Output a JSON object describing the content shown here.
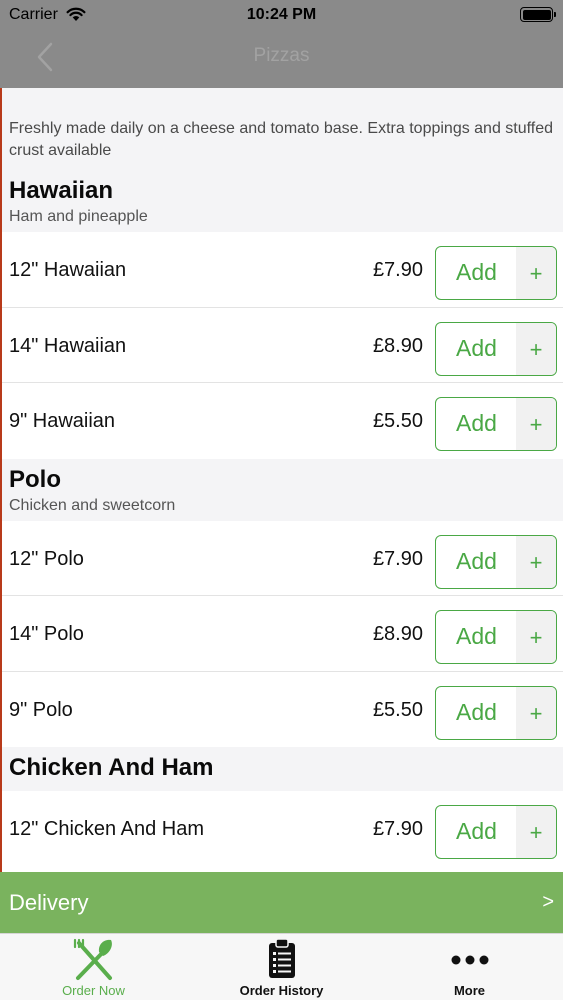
{
  "status_bar": {
    "carrier": "Carrier",
    "time": "10:24 PM"
  },
  "nav": {
    "title": "Pizzas"
  },
  "intro_text": "Freshly made daily on a cheese and tomato base. Extra toppings and stuffed crust available",
  "sections": [
    {
      "title": "Hawaiian",
      "subtitle": "Ham and pineapple",
      "items": [
        {
          "name": "12\" Hawaiian",
          "price": "£7.90"
        },
        {
          "name": "14\" Hawaiian",
          "price": "£8.90"
        },
        {
          "name": "9\" Hawaiian",
          "price": "£5.50"
        }
      ]
    },
    {
      "title": "Polo",
      "subtitle": "Chicken and sweetcorn",
      "items": [
        {
          "name": "12\" Polo",
          "price": "£7.90"
        },
        {
          "name": "14\" Polo",
          "price": "£8.90"
        },
        {
          "name": "9\" Polo",
          "price": "£5.50"
        }
      ]
    },
    {
      "title": "Chicken And Ham",
      "subtitle": "",
      "items": [
        {
          "name": "12\" Chicken And Ham",
          "price": "£7.90"
        }
      ]
    }
  ],
  "add_button": {
    "label": "Add",
    "plus": "+"
  },
  "delivery_bar": {
    "label": "Delivery",
    "arrow": ">"
  },
  "tabs": [
    {
      "label": "Order Now",
      "icon": "fork-knife-icon",
      "active": true
    },
    {
      "label": "Order History",
      "icon": "clipboard-list-icon",
      "active": false
    },
    {
      "label": "More",
      "icon": "more-dots-icon",
      "active": false
    }
  ],
  "colors": {
    "accent_green": "#4aa845",
    "delivery_bar": "#7ab35e",
    "active_tab": "#5aae4c",
    "dimmed_nav": "#8a8a8a"
  }
}
